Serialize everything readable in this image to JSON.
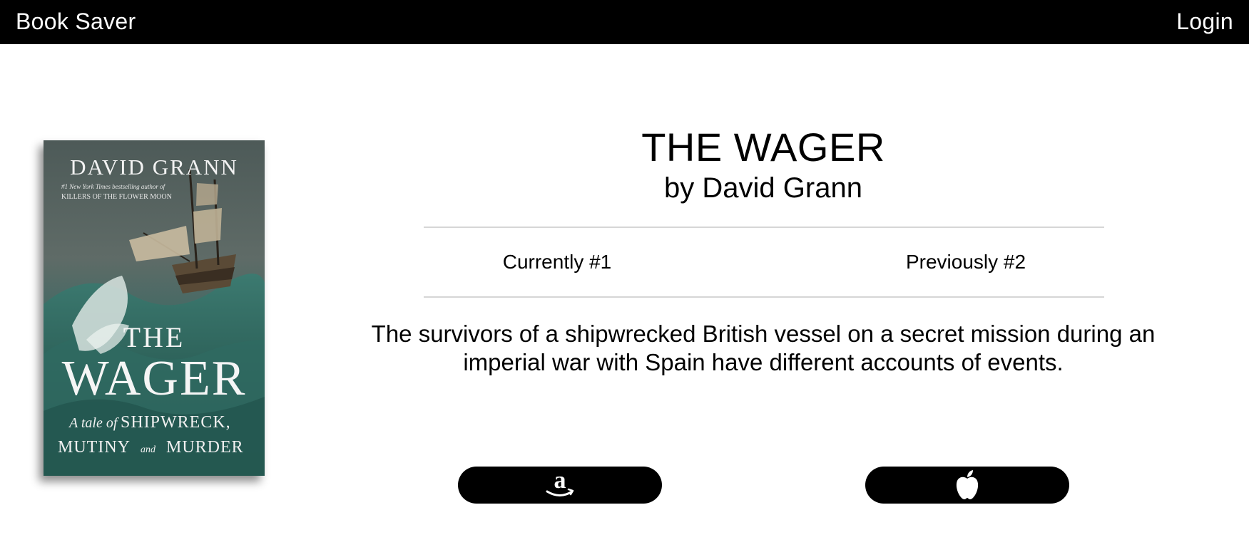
{
  "nav": {
    "brand": "Book Saver",
    "login": "Login"
  },
  "book": {
    "title": "THE WAGER",
    "author_line": "by David Grann",
    "rank_current": "Currently #1",
    "rank_previous": "Previously #2",
    "description": "The survivors of a shipwrecked British vessel on a secret mission during an imperial war with Spain have different accounts of events.",
    "cover": {
      "author": "DAVID GRANN",
      "tagline_1": "#1 New York Times bestselling author of",
      "tagline_2": "KILLERS OF THE FLOWER MOON",
      "title_1": "THE",
      "title_2": "WAGER",
      "subtitle_1a": "A tale of",
      "subtitle_1b": "SHIPWRECK,",
      "subtitle_2a": "MUTINY",
      "subtitle_2b": "and",
      "subtitle_2c": "MURDER"
    }
  },
  "stores": [
    {
      "name": "amazon",
      "icon": "amazon-icon"
    },
    {
      "name": "apple",
      "icon": "apple-icon"
    }
  ],
  "colors": {
    "navbar_bg": "#000000",
    "button_bg": "#000000",
    "rule": "#d6d6d6",
    "text": "#000000"
  }
}
